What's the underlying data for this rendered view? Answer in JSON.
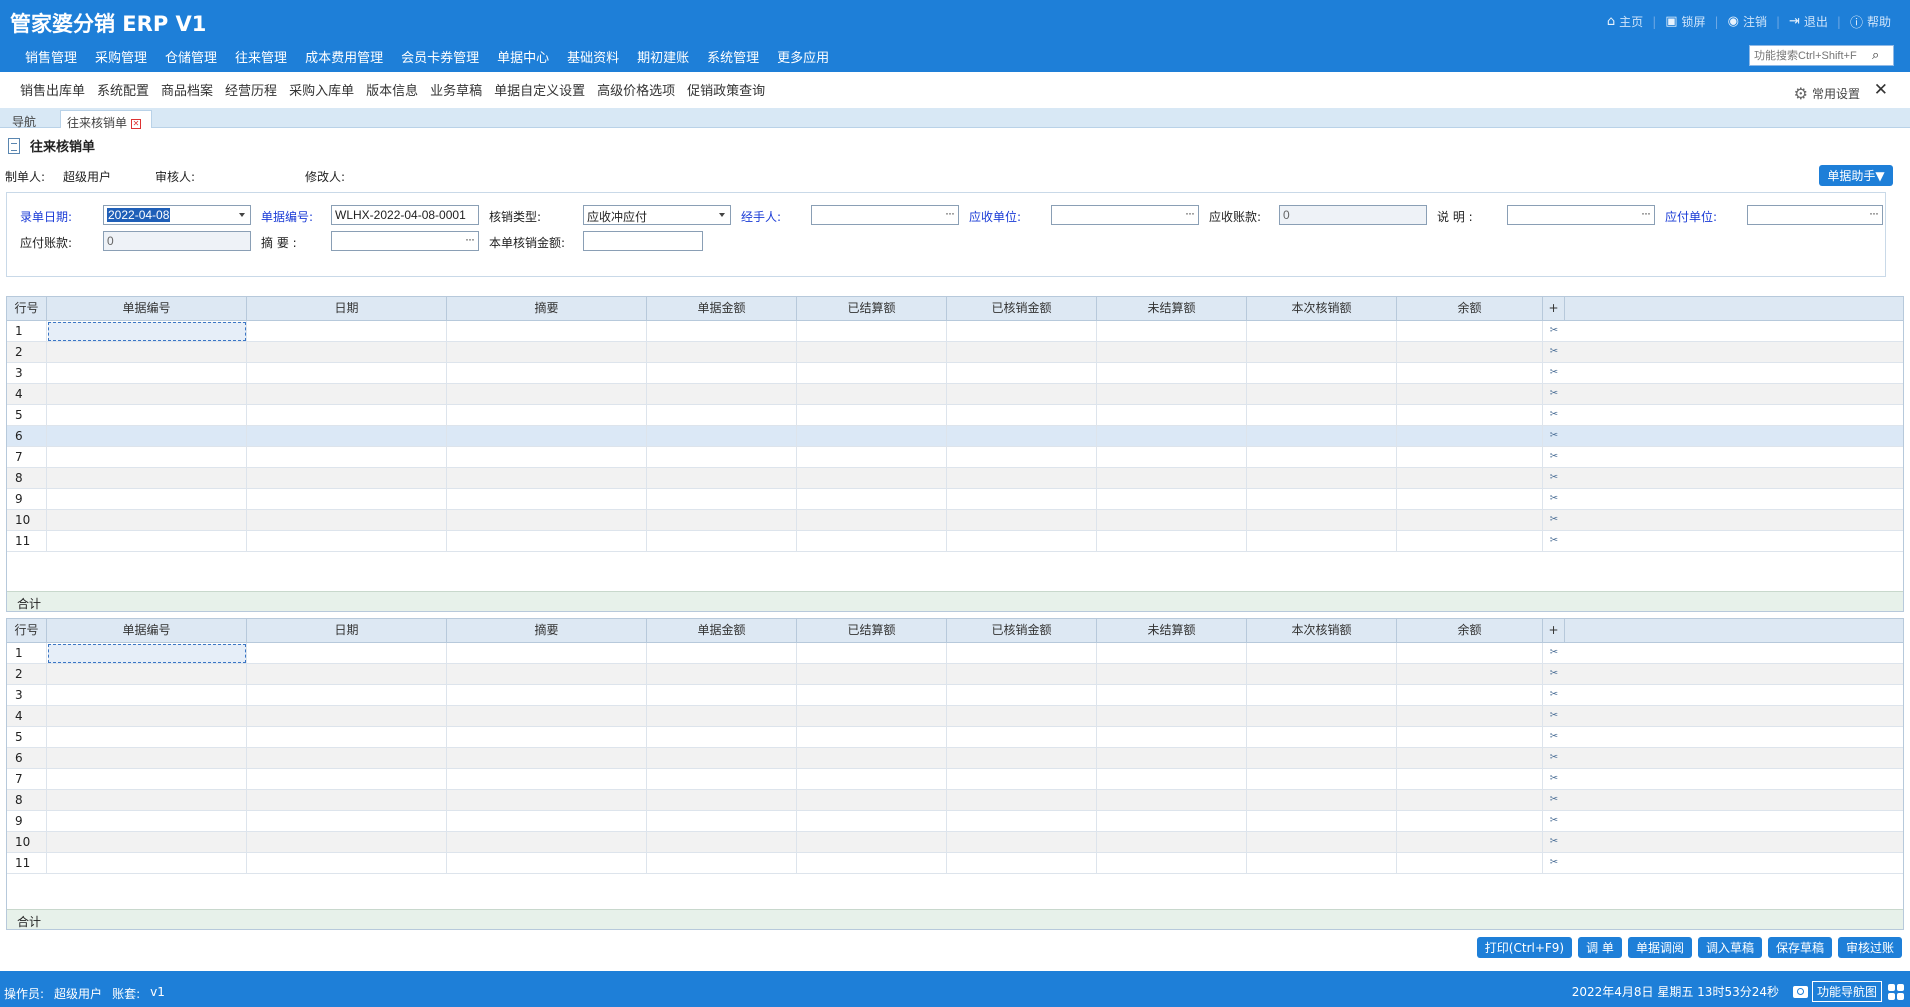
{
  "header": {
    "title": "管家婆分销 ERP V1",
    "links": [
      {
        "icon": "home-icon",
        "glyph": "⌂",
        "label": "主页"
      },
      {
        "icon": "lock-icon",
        "glyph": "🔒",
        "label": "锁屏"
      },
      {
        "icon": "logout-circle-icon",
        "glyph": "⏻",
        "label": "注销"
      },
      {
        "icon": "exit-icon",
        "glyph": "⇥",
        "label": "退出"
      },
      {
        "icon": "help-icon",
        "glyph": "ⓘ",
        "label": "帮助"
      }
    ],
    "menu": [
      "销售管理",
      "采购管理",
      "仓储管理",
      "往来管理",
      "成本费用管理",
      "会员卡券管理",
      "单据中心",
      "基础资料",
      "期初建账",
      "系统管理",
      "更多应用"
    ],
    "search_placeholder": "功能搜索Ctrl+Shift+F"
  },
  "quickbar": {
    "items": [
      "销售出库单",
      "系统配置",
      "商品档案",
      "经营历程",
      "采购入库单",
      "版本信息",
      "业务草稿",
      "单据自定义设置",
      "高级价格选项",
      "促销政策查询"
    ],
    "settings_label": "常用设置",
    "close_glyph": "✕"
  },
  "tabs": {
    "nav": "导航",
    "active": "往来核销单",
    "close_glyph": "✕"
  },
  "doc": {
    "title": "往来核销单",
    "maker_label": "制单人:",
    "maker_value": "超级用户",
    "reviewer_label": "审核人:",
    "modifier_label": "修改人:",
    "helper_button": "单据助手▼"
  },
  "form": {
    "date_label": "录单日期:",
    "date_value": "2022-04-08",
    "number_label": "单据编号:",
    "number_value": "WLHX-2022-04-08-0001",
    "type_label": "核销类型:",
    "type_value": "应收冲应付",
    "handler_label": "经手人:",
    "recv_unit_label": "应收单位:",
    "recv_amount_label": "应收账款:",
    "recv_amount_value": "0",
    "note_label": "说  明  :",
    "pay_unit_label": "应付单位:",
    "pay_amount_label": "应付账款:",
    "pay_amount_value": "0",
    "summary_label": "摘  要  :",
    "total_label": "本单核销金额:",
    "ellipsis": "···"
  },
  "grid": {
    "columns": [
      "行号",
      "单据编号",
      "日期",
      "摘要",
      "单据金额",
      "已结算额",
      "已核销金额",
      "未结算额",
      "本次核销额",
      "余额",
      "+"
    ],
    "rows": [
      "1",
      "2",
      "3",
      "4",
      "5",
      "6",
      "7",
      "8",
      "9",
      "10",
      "11"
    ],
    "total_label": "合计",
    "row_icon_glyph": "✂"
  },
  "actions": [
    "打印(Ctrl+F9)",
    "调 单",
    "单据调阅",
    "调入草稿",
    "保存草稿",
    "审核过账"
  ],
  "status": {
    "operator_label": "操作员:",
    "operator_value": "超级用户",
    "account_label": "账套:",
    "account_value": "v1",
    "datetime": "2022年4月8日  星期五  13时53分24秒",
    "nav_map": "功能导航图"
  },
  "colors": {
    "accent": "#1e7fd8",
    "label_blue": "#1a3bd6"
  }
}
